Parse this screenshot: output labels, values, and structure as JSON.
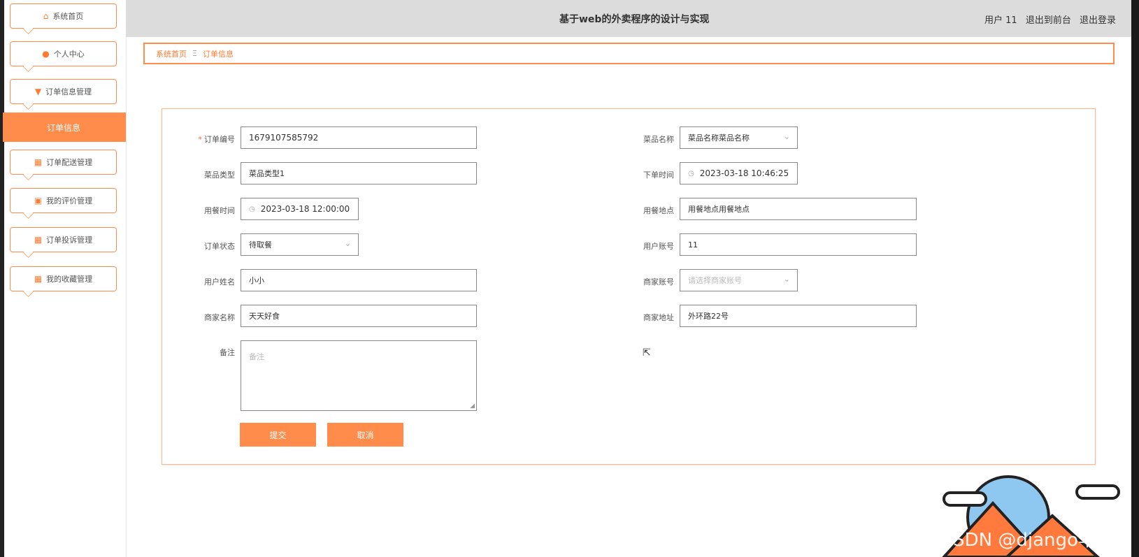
{
  "app": {
    "title": "基于web的外卖程序的设计与实现",
    "user_label": "用户 11",
    "exit_front": "退出到前台",
    "logout": "退出登录"
  },
  "sidebar": {
    "items": [
      {
        "label": "系统首页",
        "icon": "home-icon"
      },
      {
        "label": "个人中心",
        "icon": "user-icon"
      },
      {
        "label": "订单信息管理",
        "icon": "cart-icon"
      },
      {
        "label": "订单配送管理",
        "icon": "grid-icon"
      },
      {
        "label": "我的评价管理",
        "icon": "clipboard-icon"
      },
      {
        "label": "订单投诉管理",
        "icon": "grid-icon"
      },
      {
        "label": "我的收藏管理",
        "icon": "grid-icon"
      }
    ],
    "active_sub": "订单信息"
  },
  "breadcrumb": {
    "home": "系统首页",
    "separator": "Ξ",
    "current": "订单信息"
  },
  "form": {
    "order_no": {
      "label": "订单编号",
      "value": "1679107585792",
      "required": true
    },
    "dish_name": {
      "label": "菜品名称",
      "value": "菜品名称菜品名称"
    },
    "dish_type": {
      "label": "菜品类型",
      "value": "菜品类型1"
    },
    "order_time": {
      "label": "下单时间",
      "value": "2023-03-18 10:46:25"
    },
    "meal_time": {
      "label": "用餐时间",
      "value": "2023-03-18 12:00:00"
    },
    "meal_place": {
      "label": "用餐地点",
      "value": "用餐地点用餐地点"
    },
    "order_status": {
      "label": "订单状态",
      "value": "待取餐"
    },
    "user_account": {
      "label": "用户账号",
      "value": "11"
    },
    "user_name": {
      "label": "用户姓名",
      "value": "小小"
    },
    "merchant_account": {
      "label": "商家账号",
      "placeholder": "请选择商家账号"
    },
    "merchant_name": {
      "label": "商家名称",
      "value": "天天好食"
    },
    "merchant_address": {
      "label": "商家地址",
      "value": "外环路22号"
    },
    "remark": {
      "label": "备注",
      "placeholder": "备注"
    },
    "submit": "提交",
    "cancel": "取消"
  },
  "watermark": "CSDN @django毕设",
  "colors": {
    "accent": "#ff8c4a",
    "header_bg": "#dcdcdc"
  }
}
